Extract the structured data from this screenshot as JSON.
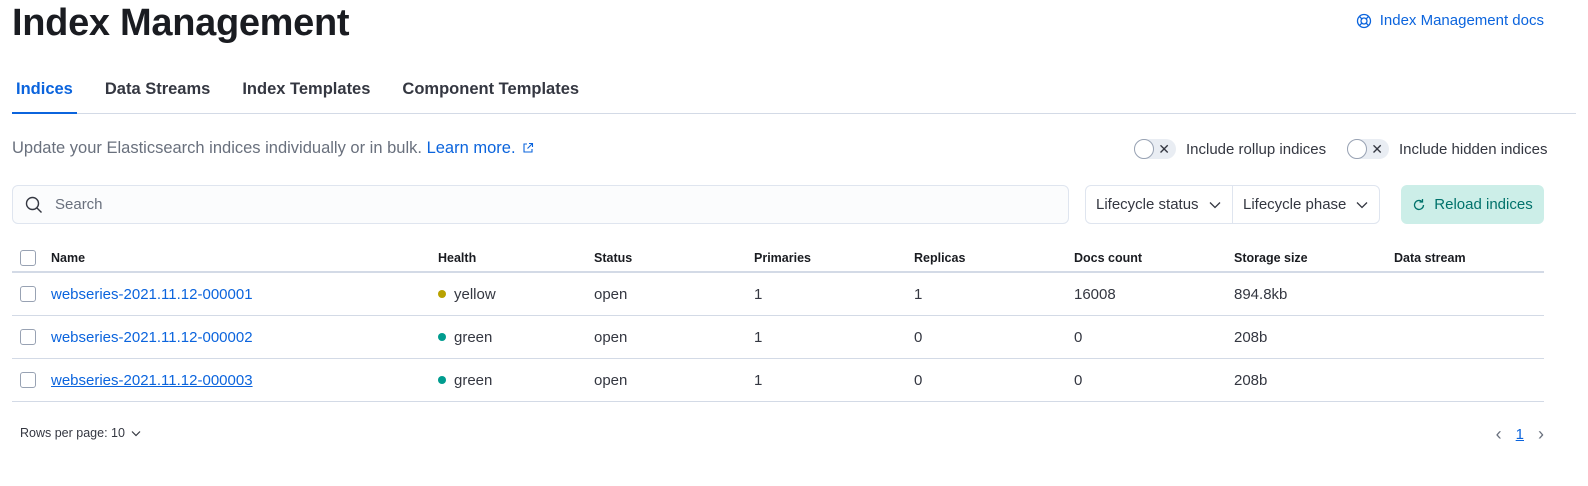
{
  "header": {
    "title": "Index Management",
    "docs_link": "Index Management docs"
  },
  "tabs": [
    {
      "label": "Indices",
      "active": true
    },
    {
      "label": "Data Streams"
    },
    {
      "label": "Index Templates"
    },
    {
      "label": "Component Templates"
    }
  ],
  "description": {
    "text": "Update your Elasticsearch indices individually or in bulk.",
    "link": "Learn more."
  },
  "toggles": {
    "rollup": "Include rollup indices",
    "hidden": "Include hidden indices"
  },
  "search": {
    "placeholder": "Search",
    "value": ""
  },
  "filters": {
    "lifecycle_status": "Lifecycle status",
    "lifecycle_phase": "Lifecycle phase"
  },
  "reload_button": "Reload indices",
  "table": {
    "columns": [
      "Name",
      "Health",
      "Status",
      "Primaries",
      "Replicas",
      "Docs count",
      "Storage size",
      "Data stream"
    ],
    "rows": [
      {
        "name": "webseries-2021.11.12-000001",
        "health": "yellow",
        "health_color": "#b9a200",
        "status": "open",
        "primaries": "1",
        "replicas": "1",
        "docs_count": "16008",
        "storage_size": "894.8kb",
        "data_stream": ""
      },
      {
        "name": "webseries-2021.11.12-000002",
        "health": "green",
        "health_color": "#009c8f",
        "status": "open",
        "primaries": "1",
        "replicas": "0",
        "docs_count": "0",
        "storage_size": "208b",
        "data_stream": ""
      },
      {
        "name": "webseries-2021.11.12-000003",
        "health": "green",
        "health_color": "#009c8f",
        "status": "open",
        "primaries": "1",
        "replicas": "0",
        "docs_count": "0",
        "storage_size": "208b",
        "data_stream": ""
      }
    ]
  },
  "pagination": {
    "rows_per_page": "Rows per page: 10",
    "current_page": "1"
  },
  "colors": {
    "accent": "#0b64dd",
    "reload_bg": "#cceee8",
    "reload_text": "#00726b"
  }
}
